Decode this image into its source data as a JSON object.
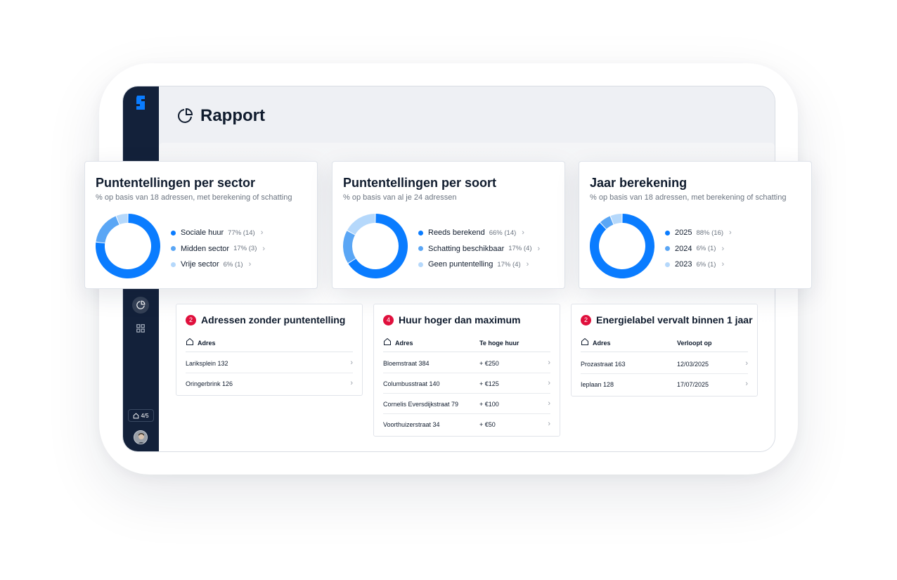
{
  "header": {
    "title": "Rapport"
  },
  "sidebar": {
    "unit_badge": "4/5"
  },
  "charts": [
    {
      "title": "Puntentellingen per sector",
      "subtitle": "% op basis van 18 adressen, met berekening of schatting",
      "items": [
        {
          "label": "Sociale huur",
          "value": "77% (14)"
        },
        {
          "label": "Midden sector",
          "value": "17% (3)"
        },
        {
          "label": "Vrije sector",
          "value": "6% (1)"
        }
      ]
    },
    {
      "title": "Puntentellingen per soort",
      "subtitle": "% op basis van al je 24 adressen",
      "items": [
        {
          "label": "Reeds berekend",
          "value": "66% (14)"
        },
        {
          "label": "Schatting beschikbaar",
          "value": "17% (4)"
        },
        {
          "label": "Geen puntentelling",
          "value": "17% (4)"
        }
      ]
    },
    {
      "title": "Jaar berekening",
      "subtitle": "% op basis van 18 adressen, met berekening of schatting",
      "items": [
        {
          "label": "2025",
          "value": "88% (16)"
        },
        {
          "label": "2024",
          "value": "6% (1)"
        },
        {
          "label": "2023",
          "value": "6% (1)"
        }
      ]
    }
  ],
  "chart_data": [
    {
      "type": "pie",
      "title": "Puntentellingen per sector",
      "categories": [
        "Sociale huur",
        "Midden sector",
        "Vrije sector"
      ],
      "values": [
        77,
        17,
        6
      ],
      "colors": [
        "#0a7cff",
        "#5aa6f5",
        "#b5d8fb"
      ]
    },
    {
      "type": "pie",
      "title": "Puntentellingen per soort",
      "categories": [
        "Reeds berekend",
        "Schatting beschikbaar",
        "Geen puntentelling"
      ],
      "values": [
        66,
        17,
        17
      ],
      "colors": [
        "#0a7cff",
        "#5aa6f5",
        "#b5d8fb"
      ]
    },
    {
      "type": "pie",
      "title": "Jaar berekening",
      "categories": [
        "2025",
        "2024",
        "2023"
      ],
      "values": [
        88,
        6,
        6
      ],
      "colors": [
        "#0a7cff",
        "#5aa6f5",
        "#b5d8fb"
      ]
    }
  ],
  "lists": [
    {
      "count": "2",
      "title": "Adressen zonder puntentelling",
      "col1": "Adres",
      "col2": "",
      "rows": [
        {
          "c1": "Lariksplein 132",
          "c2": ""
        },
        {
          "c1": "Oringerbrink 126",
          "c2": ""
        }
      ]
    },
    {
      "count": "4",
      "title": "Huur hoger dan maximum",
      "col1": "Adres",
      "col2": "Te hoge huur",
      "rows": [
        {
          "c1": "Bloemstraat 384",
          "c2": "+ €250"
        },
        {
          "c1": "Columbusstraat 140",
          "c2": "+ €125"
        },
        {
          "c1": "Cornelis Eversdijkstraat 79",
          "c2": "+ €100"
        },
        {
          "c1": "Voorthuizerstraat 34",
          "c2": "+ €50"
        }
      ]
    },
    {
      "count": "2",
      "title": "Energielabel vervalt binnen 1 jaar",
      "col1": "Adres",
      "col2": "Verloopt op",
      "rows": [
        {
          "c1": "Prozastraat 163",
          "c2": "12/03/2025"
        },
        {
          "c1": "Ieplaan 128",
          "c2": "17/07/2025"
        }
      ]
    }
  ],
  "colors": {
    "sidebar": "#13213a",
    "accent": "#0a7cff",
    "accent_mid": "#5aa6f5",
    "accent_light": "#b5d8fb",
    "badge": "#e0103d"
  },
  "icons": {
    "title": "pie-chart-icon",
    "sidebar": [
      "pie-chart-icon",
      "grid-icon"
    ],
    "column": "home-icon",
    "row_action": "chevron-right-icon"
  }
}
